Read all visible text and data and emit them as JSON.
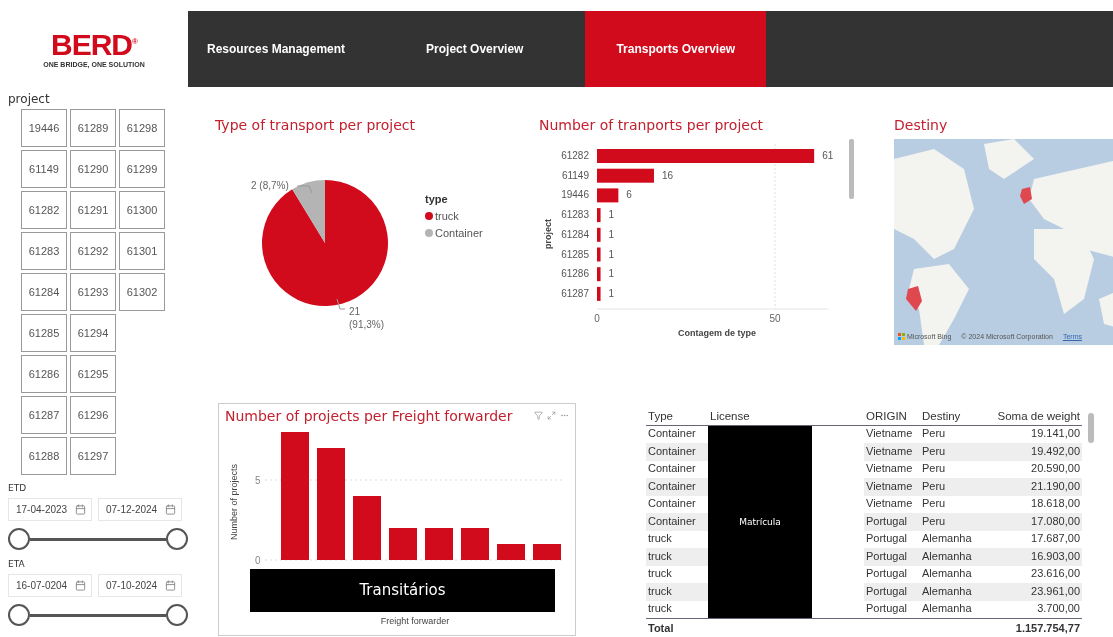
{
  "header": {
    "logo": {
      "name": "BERD",
      "mark": "®",
      "tagline": "ONE BRIDGE, ONE SOLUTION"
    },
    "tabs": [
      {
        "label": "Resources Management",
        "selected": false
      },
      {
        "label": "Project Overview",
        "selected": false
      },
      {
        "label": "Transports Overview",
        "selected": true
      }
    ]
  },
  "sidebar": {
    "project_slicer": {
      "title": "project",
      "items": [
        {
          "label": "19446",
          "selected": false
        },
        {
          "label": "61149",
          "selected": false
        },
        {
          "label": "61282",
          "selected": false
        },
        {
          "label": "61283",
          "selected": false
        },
        {
          "label": "61284",
          "selected": false
        },
        {
          "label": "61285",
          "selected": false
        },
        {
          "label": "61286",
          "selected": false
        },
        {
          "label": "61287",
          "selected": false
        },
        {
          "label": "61288",
          "selected": false
        },
        {
          "label": "61289",
          "selected": false
        },
        {
          "label": "61290",
          "selected": false
        },
        {
          "label": "61291",
          "selected": false
        },
        {
          "label": "61292",
          "selected": false
        },
        {
          "label": "61293",
          "selected": false
        },
        {
          "label": "61294",
          "selected": false
        },
        {
          "label": "61295",
          "selected": false
        },
        {
          "label": "61296",
          "selected": false
        },
        {
          "label": "61297",
          "selected": false
        },
        {
          "label": "61298",
          "selected": false
        },
        {
          "label": "61299",
          "selected": false
        },
        {
          "label": "61300",
          "selected": false
        },
        {
          "label": "61301",
          "selected": false
        },
        {
          "label": "61302",
          "selected": false
        }
      ]
    },
    "date_filters": [
      {
        "title": "ETD",
        "from": "17-04-2023",
        "to": "07-12-2024"
      },
      {
        "title": "ETA",
        "from": "16-07-0204",
        "to": "07-10-2024"
      }
    ]
  },
  "pie_panel": {
    "title": "Type of transport per project",
    "chart_data": {
      "type": "pie",
      "categories": [
        "truck",
        "Container"
      ],
      "values": [
        21,
        2
      ],
      "colors": [
        "#d10a1c",
        "#b4b4b4"
      ],
      "value_labels": [
        "21 (91,3%)",
        "2 (8,7%)"
      ],
      "legend": {
        "title": "type"
      }
    }
  },
  "bar_panel": {
    "title": "Number of tranports per project",
    "chart_data": {
      "type": "bar",
      "orientation": "horizontal",
      "ylabel": "project",
      "xlabel": "Contagem de type",
      "categories": [
        "61282",
        "61149",
        "19446",
        "61283",
        "61284",
        "61285",
        "61286",
        "61287"
      ],
      "series": [
        {
          "color": "#d10a1c",
          "values": [
            61,
            16,
            6,
            1,
            1,
            1,
            1,
            1
          ]
        }
      ],
      "xticks": [
        0,
        50
      ],
      "xlim": [
        0,
        65
      ],
      "value_labels": [
        "61",
        "16",
        "6",
        "1",
        "1",
        "1",
        "1",
        "1"
      ]
    }
  },
  "map_panel": {
    "title": "Destiny",
    "attribution": {
      "brand": "Microsoft Bing",
      "copyright": "© 2024 Microsoft Corporation",
      "link": "Terms"
    }
  },
  "forwarder_panel": {
    "title": "Number of projects per Freight forwarder",
    "chart_data": {
      "type": "bar",
      "orientation": "vertical",
      "ylabel": "Number of projects",
      "xlabel": "Freight forwarder",
      "series": [
        {
          "color": "#d10a1c",
          "values": [
            8,
            7,
            4,
            2,
            2,
            2,
            1,
            1
          ]
        }
      ],
      "yticks": [
        0,
        5
      ],
      "ylim": [
        0,
        8
      ]
    },
    "redaction_label": "Transitários"
  },
  "table": {
    "columns": [
      "Type",
      "License",
      "ORIGIN",
      "Destiny",
      "Soma de weight"
    ],
    "redaction_label": "Matrícula",
    "rows": [
      {
        "type": "Container",
        "origin": "Vietname",
        "destiny": "Peru",
        "weight": "19.141,00"
      },
      {
        "type": "Container",
        "origin": "Vietname",
        "destiny": "Peru",
        "weight": "19.492,00"
      },
      {
        "type": "Container",
        "origin": "Vietname",
        "destiny": "Peru",
        "weight": "20.590,00"
      },
      {
        "type": "Container",
        "origin": "Vietname",
        "destiny": "Peru",
        "weight": "21.190,00"
      },
      {
        "type": "Container",
        "origin": "Vietname",
        "destiny": "Peru",
        "weight": "18.618,00"
      },
      {
        "type": "Container",
        "origin": "Portugal",
        "destiny": "Peru",
        "weight": "17.080,00"
      },
      {
        "type": "truck",
        "origin": "Portugal",
        "destiny": "Alemanha",
        "weight": "17.687,00"
      },
      {
        "type": "truck",
        "origin": "Portugal",
        "destiny": "Alemanha",
        "weight": "16.903,00"
      },
      {
        "type": "truck",
        "origin": "Portugal",
        "destiny": "Alemanha",
        "weight": "23.616,00"
      },
      {
        "type": "truck",
        "origin": "Portugal",
        "destiny": "Alemanha",
        "weight": "23.961,00"
      },
      {
        "type": "truck",
        "origin": "Portugal",
        "destiny": "Alemanha",
        "weight": "3.700,00"
      }
    ],
    "total": {
      "label": "Total",
      "weight": "1.157.754,77"
    }
  }
}
